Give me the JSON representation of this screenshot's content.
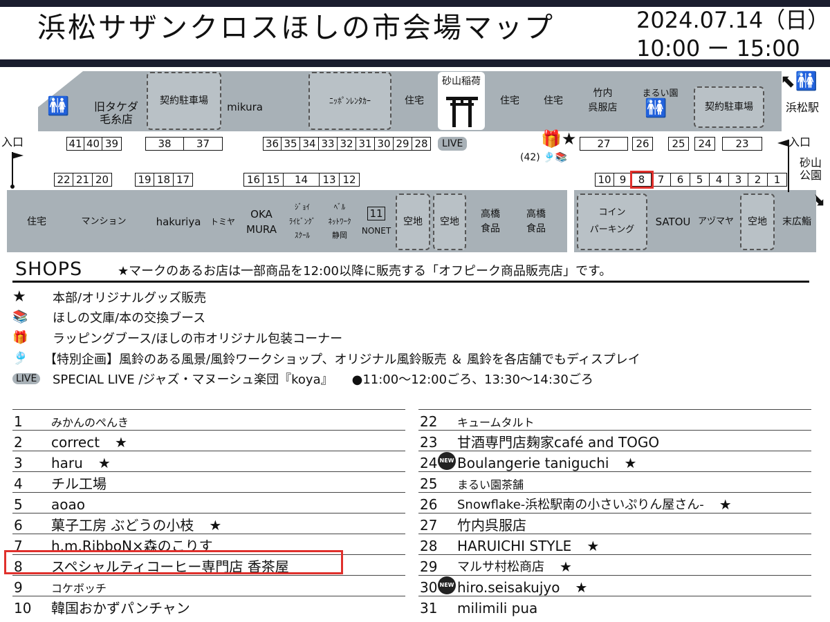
{
  "header": {
    "title": "浜松サザンクロスほしの市会場マップ",
    "date": "2024.07.14（日）",
    "time": "10:00 ー 15:00"
  },
  "map": {
    "top_blocks": [
      {
        "id": "old-takeda",
        "label": "旧タケダ\n毛糸店"
      },
      {
        "id": "parking-contract-1",
        "label": "契約駐車場"
      },
      {
        "id": "mikura",
        "label": "mikura"
      },
      {
        "id": "nippon-rentacar",
        "label": "ﾆｯﾎﾟﾝﾚﾝﾀｶｰ"
      },
      {
        "id": "house-a",
        "label": "住宅"
      },
      {
        "id": "sunayama-inari",
        "label": "砂山稲荷"
      },
      {
        "id": "house-b",
        "label": "住宅"
      },
      {
        "id": "house-c",
        "label": "住宅"
      },
      {
        "id": "takeuchi-gofuku",
        "label": "竹内\n呉服店"
      },
      {
        "id": "marui-en",
        "label": "まるい園"
      },
      {
        "id": "parking-contract-2",
        "label": "契約駐車場"
      }
    ],
    "bottom_blocks": [
      {
        "id": "house-d",
        "label": "住宅"
      },
      {
        "id": "mansion",
        "label": "マンション"
      },
      {
        "id": "hakuriya",
        "label": "hakuriya"
      },
      {
        "id": "tomika",
        "label": "トミヤ"
      },
      {
        "id": "okamura",
        "label": "OKA\nMURA"
      },
      {
        "id": "joy-living",
        "label": "ｼﾞｮｲ\nﾗｲﾋﾞﾝｸﾞ\nｽｸｰﾙ"
      },
      {
        "id": "bell-network",
        "label": "ﾍﾞﾙ\nﾈｯﾄﾜｰｸ\n静岡"
      },
      {
        "id": "nonet",
        "label": "NONET"
      },
      {
        "id": "vacant-1",
        "label": "空地"
      },
      {
        "id": "vacant-2",
        "label": "空地"
      },
      {
        "id": "takahashi-1",
        "label": "高橋\n食品"
      },
      {
        "id": "takahashi-2",
        "label": "高橋\n食品"
      },
      {
        "id": "coin-parking",
        "label": "コイン\nパーキング"
      },
      {
        "id": "satou",
        "label": "SATOU"
      },
      {
        "id": "azumaya",
        "label": "アヅマヤ"
      },
      {
        "id": "vacant-3",
        "label": "空地"
      },
      {
        "id": "suehiro",
        "label": "末広鮨"
      }
    ],
    "entrance_left": "入口",
    "entrance_right": "入口",
    "station": "浜松駅",
    "park": "砂山\n公園",
    "live": "LIVE",
    "num42": "(42)",
    "numbers_top_left": [
      "41",
      "40",
      "39"
    ],
    "numbers_top_38_37": [
      "38",
      "37"
    ],
    "numbers_top_mid": [
      "36",
      "35",
      "34",
      "33",
      "32",
      "31",
      "30",
      "29",
      "28"
    ],
    "numbers_top_27": [
      "27"
    ],
    "numbers_top_26": [
      "26"
    ],
    "numbers_top_25_24": [
      "25",
      "24"
    ],
    "numbers_top_23": [
      "23"
    ],
    "numbers_bot_a": [
      "22",
      "21",
      "20"
    ],
    "numbers_bot_b": [
      "19",
      "18",
      "17"
    ],
    "numbers_bot_c": [
      "16",
      "15",
      "14",
      "13",
      "12"
    ],
    "numbers_bot_11": "11",
    "numbers_bot_d": [
      "10",
      "9",
      "8",
      "7",
      "6",
      "5",
      "4",
      "3",
      "2",
      "1"
    ],
    "highlighted_number": "8"
  },
  "legend": {
    "heading": "SHOPS",
    "note": "★マークのあるお店は一部商品を12:00以降に販売する「オフピーク商品販売店」です。",
    "items": [
      {
        "icon": "star-icon",
        "glyph": "★",
        "text": "本部/オリジナルグッズ販売"
      },
      {
        "icon": "books-icon",
        "glyph": "📚",
        "text": "ほしの文庫/本の交換ブース"
      },
      {
        "icon": "gift-icon",
        "glyph": "🎁",
        "text": "ラッピングブース/ほしの市オリジナル包装コーナー"
      },
      {
        "icon": "windchime-icon",
        "glyph": "🎐",
        "text": "【特別企画】風鈴のある風景/風鈴ワークショップ、オリジナル風鈴販売 ＆ 風鈴を各店舗でもディスプレイ"
      },
      {
        "icon": "live-icon",
        "glyph": "LIVE",
        "text": "SPECIAL LIVE /ジャズ・マヌーシュ楽団『koya』　　●11:00〜12:00ごろ、13:30〜14:30ごろ"
      }
    ]
  },
  "shops_left": [
    {
      "num": "1",
      "name": "みかんのぺんき",
      "star": ""
    },
    {
      "num": "2",
      "name": "correct",
      "star": "★"
    },
    {
      "num": "3",
      "name": "haru",
      "star": "★"
    },
    {
      "num": "4",
      "name": "チル工場",
      "star": ""
    },
    {
      "num": "5",
      "name": "aoao",
      "star": ""
    },
    {
      "num": "6",
      "name": "菓子工房 ぶどうの小枝",
      "star": "★"
    },
    {
      "num": "7",
      "name": "h.m.RibboN×森のこりす",
      "star": ""
    },
    {
      "num": "8",
      "name": "スペシャルティコーヒー専門店 香茶屋",
      "star": ""
    },
    {
      "num": "9",
      "name": "コケボッチ",
      "star": ""
    },
    {
      "num": "10",
      "name": "韓国おかずパンチャン",
      "star": ""
    }
  ],
  "shops_right": [
    {
      "num": "22",
      "name": "キュームタルト",
      "star": "",
      "new": ""
    },
    {
      "num": "23",
      "name": "甘酒専門店麹家café and TOGO",
      "star": "",
      "new": ""
    },
    {
      "num": "24",
      "name": "Boulangerie taniguchi",
      "star": "★",
      "new": "NEW"
    },
    {
      "num": "25",
      "name": "まるい園茶舗",
      "star": "",
      "new": ""
    },
    {
      "num": "26",
      "name": "Snowflake-浜松駅南の小さいぷりん屋さん-",
      "star": "★",
      "new": ""
    },
    {
      "num": "27",
      "name": "竹内呉服店",
      "star": "",
      "new": ""
    },
    {
      "num": "28",
      "name": "HARUICHI STYLE",
      "star": "★",
      "new": ""
    },
    {
      "num": "29",
      "name": "マルサ村松商店",
      "star": "★",
      "new": ""
    },
    {
      "num": "30",
      "name": "hiro.seisakujyo",
      "star": "★",
      "new": "NEW"
    },
    {
      "num": "31",
      "name": "milimili pua",
      "star": "",
      "new": ""
    }
  ]
}
